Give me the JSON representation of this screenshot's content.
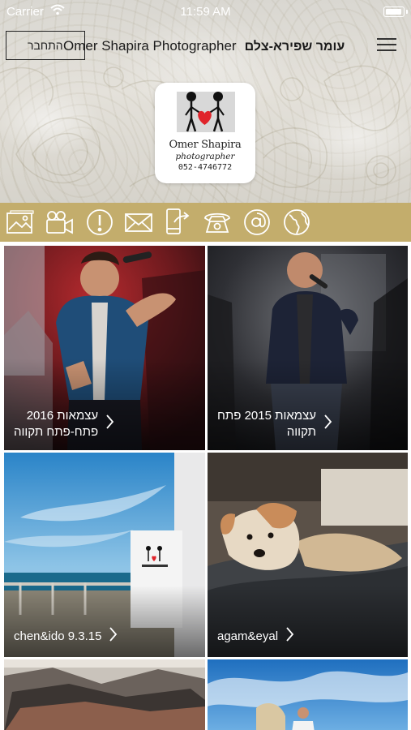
{
  "status_bar": {
    "carrier": "Carrier",
    "time": "11:59 AM"
  },
  "header": {
    "login_label": "התחבר",
    "title_hebrew": "עומר שפירא-צלם",
    "title_english": "Omer Shapira Photographer"
  },
  "logo": {
    "name": "Omer Shapira",
    "subtitle": "photographer",
    "phone": "052-4746772",
    "heart_color": "#e0242b"
  },
  "toolbar": {
    "background": "#c3ad6c",
    "icons": [
      "gallery-icon",
      "video-icon",
      "info-icon",
      "mail-icon",
      "share-icon",
      "phone-icon",
      "at-icon",
      "globe-icon"
    ]
  },
  "gallery": {
    "items": [
      {
        "line1": "עצמאות 2016",
        "line2": "פתח-פתח תקווה"
      },
      {
        "line1": "עצמאות 2015 פתח",
        "line2": "תקווה"
      },
      {
        "line1": "chen&ido 9.3.15",
        "line2": ""
      },
      {
        "line1": "agam&eyal",
        "line2": ""
      },
      {
        "line1": "",
        "line2": ""
      },
      {
        "line1": "",
        "line2": ""
      }
    ]
  }
}
